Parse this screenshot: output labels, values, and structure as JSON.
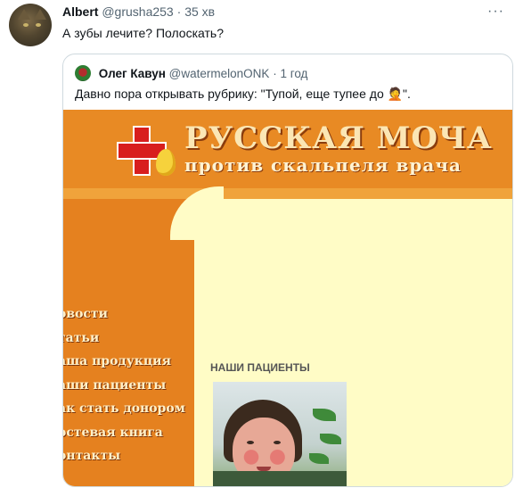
{
  "tweet": {
    "author_name": "Albert",
    "author_handle": "@grusha253",
    "separator": "·",
    "time": "35 хв",
    "more": "···",
    "text": "А зубы лечите? Полоскать?"
  },
  "quoted_tweet": {
    "author_name": "Олег Кавун",
    "author_handle": "@watermelonONK",
    "separator": "·",
    "time": "1 год",
    "text": "Давно пора открывать рубрику: \"Тупой, еще тупее до 🤦\"."
  },
  "media": {
    "site_title": "РУССКАЯ МОЧА",
    "site_subtitle": "против скальпеля врача",
    "menu_items": [
      "овости",
      "татьи",
      "аша продукция",
      "аши пациенты",
      "ак стать донором",
      "остевая книга",
      "онтакты"
    ],
    "section_title": "НАШИ ПАЦИЕНТЫ"
  },
  "colors": {
    "banner": "#e88a24",
    "sidebar": "#e5811f",
    "content_bg": "#fffcc6",
    "cross": "#d81e1e"
  }
}
